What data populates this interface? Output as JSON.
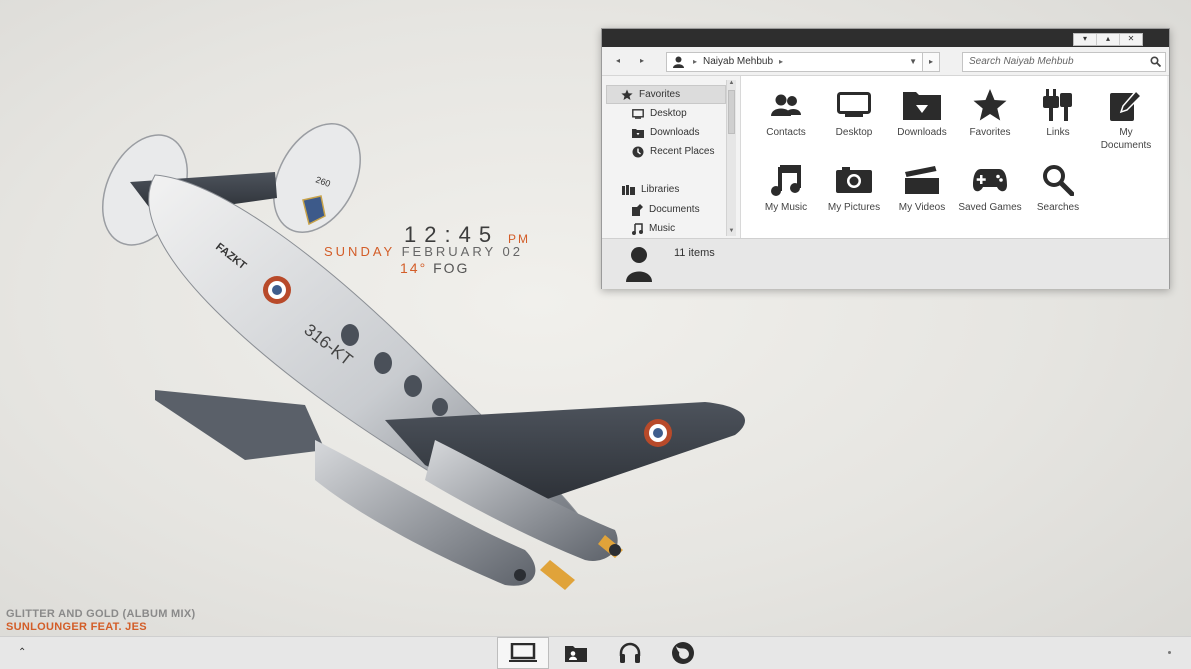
{
  "desktop": {
    "clock": {
      "time": "12:45",
      "ampm": "PM",
      "day": "SUNDAY",
      "date": "FEBRUARY 02",
      "temp": "14°",
      "condition": "FOG"
    },
    "now_playing": {
      "song": "GLITTER AND GOLD (ALBUM MIX)",
      "artist": "SUNLOUNGER FEAT. JES"
    },
    "wallpaper": {
      "plane_markings": [
        "FAZKT",
        "260",
        "316-KT"
      ]
    }
  },
  "window": {
    "caption_buttons": [
      "▾",
      "▴",
      "✕"
    ],
    "address": {
      "path": "Naiyab Mehbub"
    },
    "search": {
      "placeholder": "Search Naiyab Mehbub"
    },
    "sidebar": {
      "favorites_label": "Favorites",
      "favorites": [
        "Desktop",
        "Downloads",
        "Recent Places"
      ],
      "libraries_label": "Libraries",
      "libraries": [
        "Documents",
        "Music"
      ]
    },
    "items": [
      {
        "label": "Contacts",
        "icon": "contacts-icon"
      },
      {
        "label": "Desktop",
        "icon": "desktop-icon"
      },
      {
        "label": "Downloads",
        "icon": "downloads-folder-icon"
      },
      {
        "label": "Favorites",
        "icon": "star-icon"
      },
      {
        "label": "Links",
        "icon": "links-icon"
      },
      {
        "label": "My Documents",
        "icon": "documents-icon"
      },
      {
        "label": "My Music",
        "icon": "music-note-icon"
      },
      {
        "label": "My Pictures",
        "icon": "camera-icon"
      },
      {
        "label": "My Videos",
        "icon": "clapperboard-icon"
      },
      {
        "label": "Saved Games",
        "icon": "gamepad-icon"
      },
      {
        "label": "Searches",
        "icon": "search-icon"
      }
    ],
    "item_count": "11 items"
  },
  "taskbar": {
    "apps": [
      "computer-icon",
      "user-folder-icon",
      "headphones-icon",
      "firefox-icon"
    ],
    "tray_icon": "chevron-up-icon"
  },
  "colors": {
    "accent": "#d35d28",
    "titlebar": "#2e2e2e",
    "icon": "#2b2b2b"
  }
}
